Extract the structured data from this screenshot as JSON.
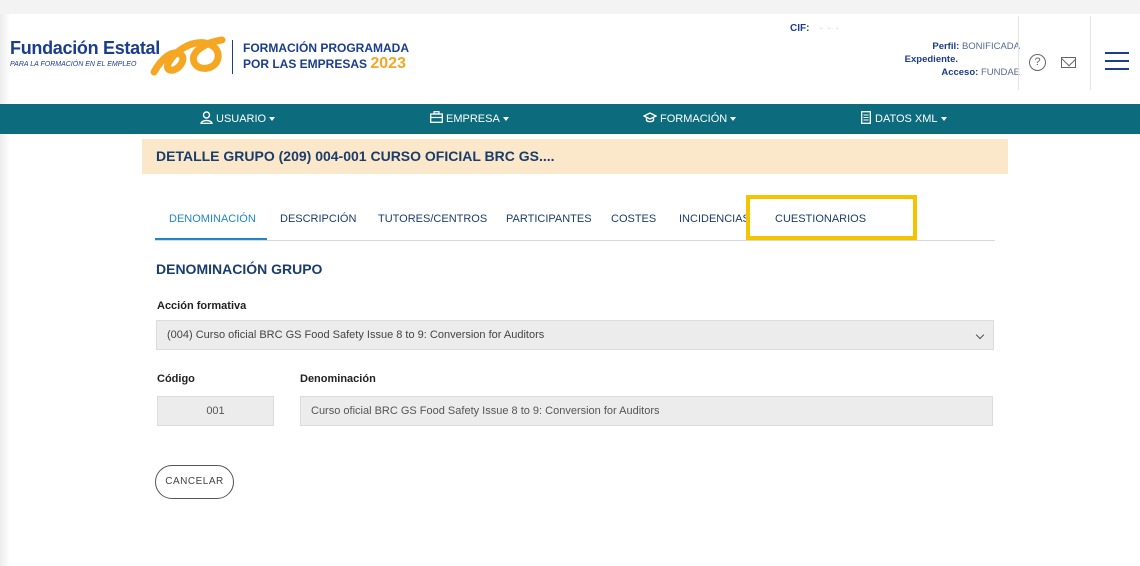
{
  "header": {
    "brand_title": "Fundación Estatal",
    "brand_subtitle": "PARA LA FORMACIÓN EN EL EMPLEO",
    "program_line1": "FORMACIÓN PROGRAMADA",
    "program_line2": "POR LAS EMPRESAS",
    "program_year": "2023",
    "cif_label": "CIF:",
    "cif_value": "· · ·",
    "perfil_label": "Perfil:",
    "perfil_value": "BONIFICADA",
    "expediente_label": "Expediente.",
    "expediente_value": "",
    "acceso_label": "Acceso:",
    "acceso_value": "FUNDAE",
    "help_icon": "help-circle-icon",
    "mail_icon": "mail-icon",
    "menu_icon": "hamburger-menu-icon"
  },
  "navbar": {
    "items": [
      {
        "label": "USUARIO",
        "icon": "user-icon"
      },
      {
        "label": "EMPRESA",
        "icon": "briefcase-icon"
      },
      {
        "label": "FORMACIÓN",
        "icon": "graduation-cap-icon"
      },
      {
        "label": "DATOS XML",
        "icon": "document-icon"
      }
    ]
  },
  "page": {
    "title": "DETALLE GRUPO (209) 004-001 CURSO OFICIAL BRC GS...."
  },
  "tabs": [
    {
      "label": "DENOMINACIÓN",
      "active": true
    },
    {
      "label": "DESCRIPCIÓN",
      "active": false
    },
    {
      "label": "TUTORES/CENTROS",
      "active": false
    },
    {
      "label": "PARTICIPANTES",
      "active": false
    },
    {
      "label": "COSTES",
      "active": false
    },
    {
      "label": "INCIDENCIAS",
      "active": false
    },
    {
      "label": "CUESTIONARIOS",
      "active": false
    }
  ],
  "form": {
    "section_title": "DENOMINACIÓN GRUPO",
    "accion_label": "Acción formativa",
    "accion_value": "(004) Curso oficial BRC GS Food Safety Issue 8 to 9: Conversion for Auditors",
    "codigo_label": "Código",
    "codigo_value": "001",
    "denominacion_label": "Denominación",
    "denominacion_value": "Curso oficial BRC GS Food Safety Issue 8 to 9: Conversion for Auditors",
    "cancel_label": "CANCELAR"
  },
  "colors": {
    "navbar": "#0d6b7e",
    "title_band": "#fbe7c9",
    "active_tab": "#1e88c8",
    "highlight": "#f5c400",
    "brand": "#1a3d8c",
    "year": "#f5a623"
  }
}
